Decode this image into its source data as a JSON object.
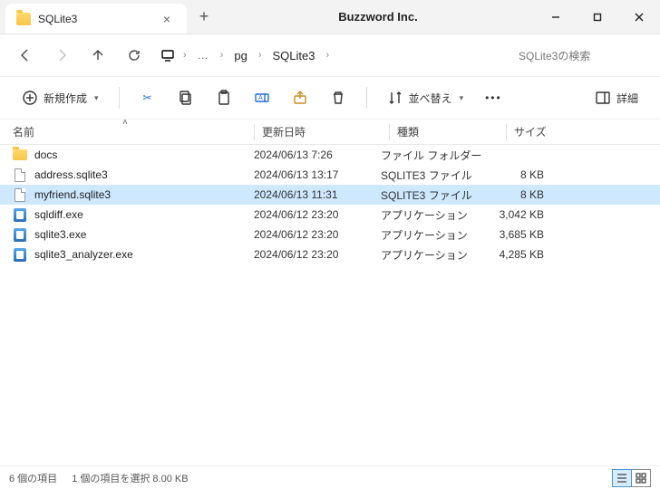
{
  "app_title": "Buzzword Inc.",
  "tab": {
    "title": "SQLite3"
  },
  "breadcrumb": {
    "seg1": "pg",
    "seg2": "SQLite3"
  },
  "search": {
    "placeholder": "SQLite3の検索"
  },
  "commands": {
    "new": "新規作成",
    "sort": "並べ替え",
    "details": "詳細"
  },
  "columns": {
    "name": "名前",
    "date": "更新日時",
    "type": "種類",
    "size": "サイズ"
  },
  "rows": [
    {
      "name": "docs",
      "date": "2024/06/13 7:26",
      "type": "ファイル フォルダー",
      "size": "",
      "icon": "folder",
      "selected": false
    },
    {
      "name": "address.sqlite3",
      "date": "2024/06/13 13:17",
      "type": "SQLITE3 ファイル",
      "size": "8 KB",
      "icon": "file",
      "selected": false
    },
    {
      "name": "myfriend.sqlite3",
      "date": "2024/06/13 11:31",
      "type": "SQLITE3 ファイル",
      "size": "8 KB",
      "icon": "file",
      "selected": true
    },
    {
      "name": "sqldiff.exe",
      "date": "2024/06/12 23:20",
      "type": "アプリケーション",
      "size": "3,042 KB",
      "icon": "exe",
      "selected": false
    },
    {
      "name": "sqlite3.exe",
      "date": "2024/06/12 23:20",
      "type": "アプリケーション",
      "size": "3,685 KB",
      "icon": "exe",
      "selected": false
    },
    {
      "name": "sqlite3_analyzer.exe",
      "date": "2024/06/12 23:20",
      "type": "アプリケーション",
      "size": "4,285 KB",
      "icon": "exe",
      "selected": false
    }
  ],
  "status": {
    "count": "6 個の項目",
    "selection": "1 個の項目を選択 8.00 KB"
  }
}
